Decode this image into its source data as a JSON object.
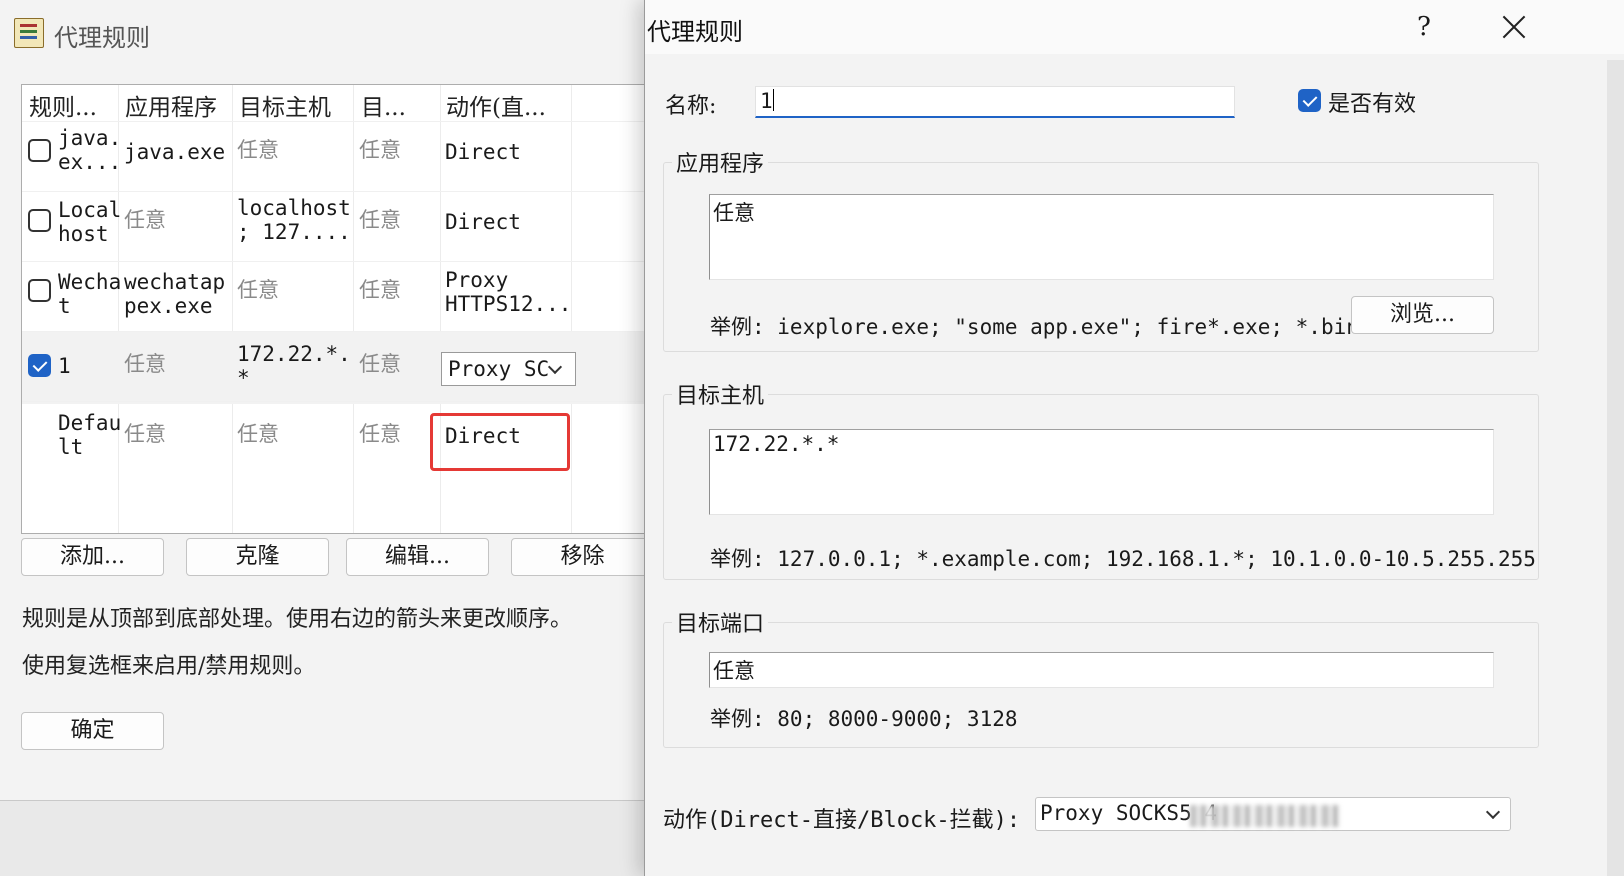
{
  "back_window": {
    "title": "代理规则",
    "columns": [
      "规则...",
      "应用程序",
      "目标主机",
      "目...",
      "动作(直..."
    ],
    "rows": [
      {
        "checked": false,
        "name": "java.\nex...",
        "app": "java.exe",
        "host": "任意",
        "port": "任意",
        "action": "Direct",
        "app_gray": false,
        "host_gray": true
      },
      {
        "checked": false,
        "name": "Local\nhost",
        "app": "任意",
        "host": "localhost\n; 127....",
        "port": "任意",
        "action": "Direct",
        "app_gray": true,
        "host_gray": false
      },
      {
        "checked": false,
        "name": "Wecha\nt",
        "app": "wechatap\npex.exe",
        "host": "任意",
        "port": "任意",
        "action": "Proxy\nHTTPS12...",
        "app_gray": false,
        "host_gray": true
      },
      {
        "checked": true,
        "name": "1",
        "app": "任意",
        "host": "172.22.*.\n*",
        "port": "任意",
        "action": "Proxy SC",
        "app_gray": true,
        "host_gray": false
      },
      {
        "checked": null,
        "name": "Defau\nlt",
        "app": "任意",
        "host": "任意",
        "port": "任意",
        "action": "Direct",
        "app_gray": true,
        "host_gray": true
      }
    ],
    "buttons": {
      "add": "添加...",
      "clone": "克隆",
      "edit": "编辑...",
      "remove": "移除"
    },
    "note1": "规则是从顶部到底部处理。使用右边的箭头来更改顺序。",
    "note2": "使用复选框来启用/禁用规则。",
    "ok": "确定"
  },
  "dialog": {
    "title": "代理规则",
    "help": "?",
    "name_label": "名称:",
    "name_value": "1",
    "enabled_label": "是否有效",
    "enabled": true,
    "app_group": {
      "title": "应用程序",
      "value": "任意",
      "example": "举例: iexplore.exe; \"some app.exe\"; fire*.exe; *.bin",
      "browse": "浏览..."
    },
    "host_group": {
      "title": "目标主机",
      "value": "172.22.*.*",
      "example": "举例: 127.0.0.1; *.example.com; 192.168.1.*; 10.1.0.0-10.5.255.255"
    },
    "port_group": {
      "title": "目标端口",
      "value": "任意",
      "example": "举例: 80; 8000-9000; 3128"
    },
    "action_label": "动作(Direct-直接/Block-拦截):",
    "action_value": "Proxy SOCKS5 4"
  }
}
